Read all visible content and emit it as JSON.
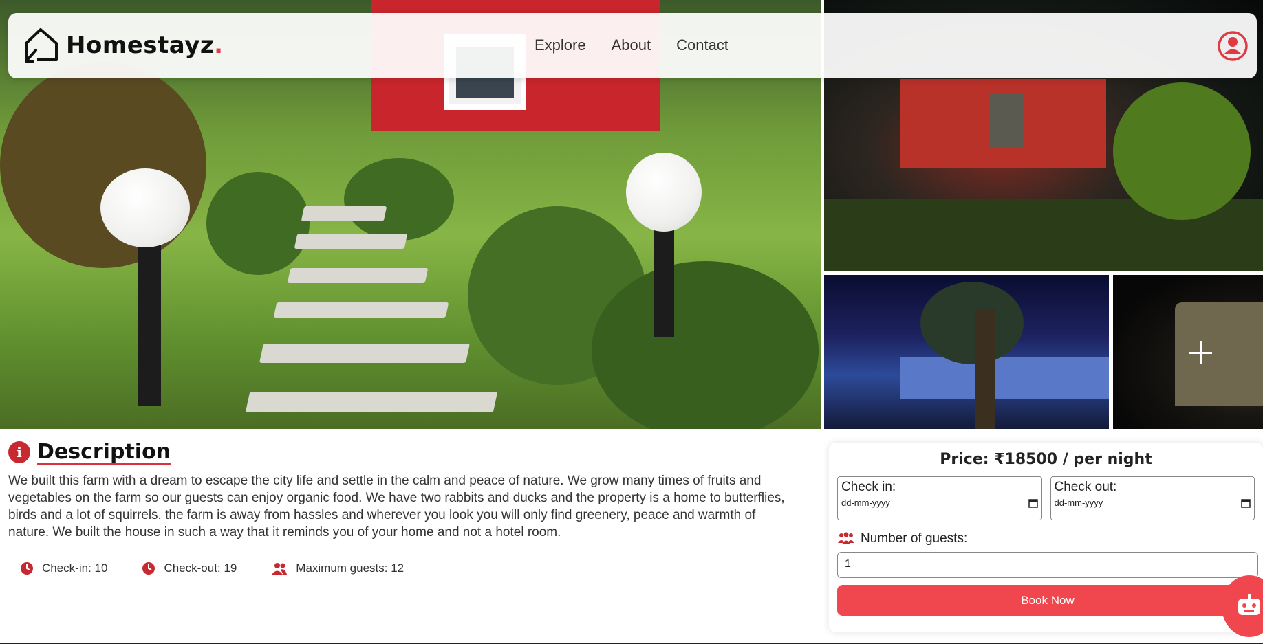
{
  "navbar": {
    "logo_text": "Homestayz",
    "logo_dot": ".",
    "links": [
      "Explore",
      "About",
      "Contact"
    ]
  },
  "gallery": {
    "more_icon": "plus-icon"
  },
  "description": {
    "title": "Description",
    "text": "We built this farm with a dream to escape the city life and settle in the calm and peace of nature. We grow many times of fruits and vegetables on the farm so our guests can enjoy organic food. We have two rabbits and ducks and the property is a home to butterflies, birds and a lot of squirrels. the farm is away from hassles and wherever you look you will only find greenery, peace and warmth of nature. We built the house in such a way that it reminds you of your home and not a hotel room.",
    "facts": {
      "checkin": "Check-in: 10",
      "checkout": "Check-out: 19",
      "max_guests": "Maximum guests: 12"
    }
  },
  "booking": {
    "price": "Price: ₹18500 / per night",
    "checkin_label": "Check in:",
    "checkout_label": "Check out:",
    "date_placeholder": "dd-mm-yyyy",
    "guests_label": "Number of guests:",
    "guests_value": "1",
    "book_button": "Book Now"
  },
  "colors": {
    "accent": "#f0474f",
    "icon_red": "#c8282f"
  }
}
